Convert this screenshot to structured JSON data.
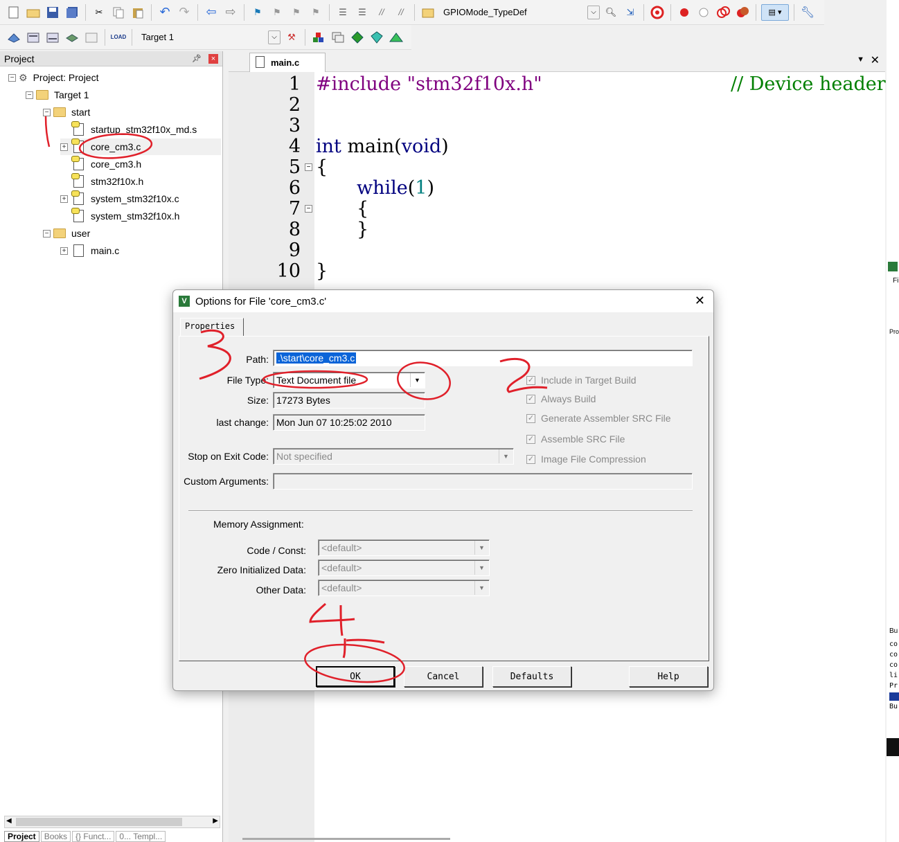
{
  "toolbar": {
    "func_combo": "GPIOMode_TypeDef",
    "target_combo": "Target 1"
  },
  "project_panel": {
    "title": "Project",
    "tree": {
      "project": "Project: Project",
      "target": "Target 1",
      "group_start": "start",
      "files_start": [
        "startup_stm32f10x_md.s",
        "core_cm3.c",
        "core_cm3.h",
        "stm32f10x.h",
        "system_stm32f10x.c",
        "system_stm32f10x.h"
      ],
      "group_user": "user",
      "files_user": [
        "main.c"
      ]
    },
    "bottom_tabs": [
      "Project",
      "Books",
      "{} Funct...",
      "0... Templ..."
    ]
  },
  "editor": {
    "tab_label": "main.c",
    "line_numbers": [
      "1",
      "2",
      "3",
      "4",
      "5",
      "6",
      "7",
      "8",
      "9",
      "10"
    ],
    "code": {
      "l1_include": "#include",
      "l1_header": "\"stm32f10x.h\"",
      "l1_comment": "// Device header",
      "l4_int": "int",
      "l4_main": " main(",
      "l4_void": "void",
      "l4_close": ")",
      "l5": "{",
      "l6_while": "while",
      "l6_open": "(",
      "l6_num": "1",
      "l6_close": ")",
      "l7": "{",
      "l8": "}",
      "l10": "}"
    }
  },
  "dialog": {
    "title": "Options for File 'core_cm3.c'",
    "tab": "Properties",
    "path_label": "Path:",
    "path_value": ".\\start\\core_cm3.c",
    "file_type_label": "File Type:",
    "file_type_value": "Text Document file",
    "size_label": "Size:",
    "size_value": "17273 Bytes",
    "last_change_label": "last change:",
    "last_change_value": "Mon Jun 07 10:25:02 2010",
    "stop_label": "Stop on Exit Code:",
    "stop_value": "Not specified",
    "custom_args_label": "Custom Arguments:",
    "custom_args_value": "",
    "checkboxes": [
      "Include in Target Build",
      "Always Build",
      "Generate Assembler SRC File",
      "Assemble SRC File",
      "Image File Compression"
    ],
    "memory_label": "Memory Assignment:",
    "code_const_label": "Code / Const:",
    "zero_init_label": "Zero Initialized Data:",
    "other_data_label": "Other Data:",
    "mem_default": "<default>",
    "buttons": {
      "ok": "OK",
      "cancel": "Cancel",
      "defaults": "Defaults",
      "help": "Help"
    }
  },
  "annotations": [
    "1",
    "2",
    "3",
    "4",
    "5"
  ],
  "right_strip": [
    "Fi",
    "Pro",
    "Bu",
    "co",
    "co",
    "co",
    "li",
    "Pr",
    "Bu"
  ]
}
